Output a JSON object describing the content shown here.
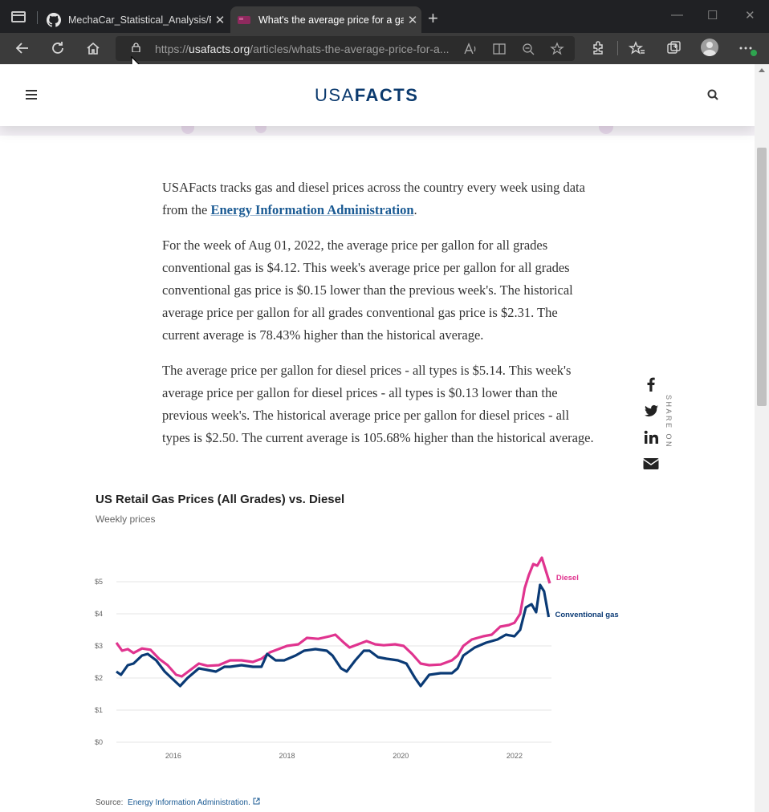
{
  "browser": {
    "tabs": [
      {
        "title": "MechaCar_Statistical_Analysis/RE",
        "close": "✕",
        "active": false
      },
      {
        "title": "What's the average price for a gas",
        "close": "✕",
        "active": true
      }
    ],
    "new_tab": "+",
    "url": {
      "prefix": "https://",
      "host": "usafacts.org",
      "path": "/articles/whats-the-average-price-for-a..."
    },
    "window_controls": {
      "minimize": "—",
      "maximize": "☐",
      "close": "✕"
    }
  },
  "site": {
    "logo_left": "USA",
    "logo_right": "FACTS"
  },
  "article": {
    "p1_before": "USAFacts tracks gas and diesel prices across the country every week using data from the ",
    "p1_link": "Energy Information Administration",
    "p1_after": ".",
    "p2": "For the week of Aug 01, 2022, the average price per gallon for all grades conventional gas is $4.12. This week's average price per gallon for all grades conventional gas price is $0.15 lower than the previous week's. The historical average price per gallon for all grades conventional gas price is $2.31. The current average is 78.43% higher than the historical average.",
    "p3": "The average price per gallon for diesel prices - all types is $5.14. This week's average price per gallon for diesel prices - all types is $0.13 lower than the previous week's. The historical average price per gallon for diesel prices - all types is $2.50. The current average is 105.68% higher than the historical average."
  },
  "share": {
    "label": "SHARE ON"
  },
  "chart_data": {
    "type": "line",
    "title": "US Retail Gas Prices (All Grades) vs. Diesel",
    "subtitle": "Weekly prices",
    "xlabel": "",
    "ylabel": "",
    "xlim": [
      2015.0,
      2022.65
    ],
    "ylim": [
      0,
      5.5
    ],
    "x_ticks": [
      2016,
      2018,
      2020,
      2022
    ],
    "x_tick_labels": [
      "2016",
      "2018",
      "2020",
      "2022"
    ],
    "y_ticks": [
      0,
      1,
      2,
      3,
      4,
      5
    ],
    "y_tick_labels": [
      "$0",
      "$1",
      "$2",
      "$3",
      "$4",
      "$5"
    ],
    "grid": true,
    "legend": "inline-right",
    "series": [
      {
        "name": "Diesel",
        "color": "#e0348f",
        "points": [
          [
            2015.0,
            3.1
          ],
          [
            2015.1,
            2.85
          ],
          [
            2015.2,
            2.9
          ],
          [
            2015.3,
            2.78
          ],
          [
            2015.45,
            2.92
          ],
          [
            2015.6,
            2.88
          ],
          [
            2015.75,
            2.6
          ],
          [
            2015.9,
            2.4
          ],
          [
            2016.05,
            2.1
          ],
          [
            2016.15,
            2.05
          ],
          [
            2016.3,
            2.25
          ],
          [
            2016.45,
            2.45
          ],
          [
            2016.6,
            2.38
          ],
          [
            2016.8,
            2.4
          ],
          [
            2017.0,
            2.55
          ],
          [
            2017.2,
            2.55
          ],
          [
            2017.4,
            2.5
          ],
          [
            2017.55,
            2.6
          ],
          [
            2017.7,
            2.8
          ],
          [
            2017.85,
            2.9
          ],
          [
            2018.0,
            3.0
          ],
          [
            2018.2,
            3.05
          ],
          [
            2018.35,
            3.25
          ],
          [
            2018.55,
            3.22
          ],
          [
            2018.75,
            3.3
          ],
          [
            2018.85,
            3.35
          ],
          [
            2019.0,
            3.1
          ],
          [
            2019.1,
            2.95
          ],
          [
            2019.25,
            3.05
          ],
          [
            2019.4,
            3.15
          ],
          [
            2019.55,
            3.05
          ],
          [
            2019.7,
            3.02
          ],
          [
            2019.9,
            3.05
          ],
          [
            2020.05,
            3.0
          ],
          [
            2020.2,
            2.75
          ],
          [
            2020.35,
            2.45
          ],
          [
            2020.5,
            2.4
          ],
          [
            2020.7,
            2.42
          ],
          [
            2020.9,
            2.55
          ],
          [
            2021.0,
            2.7
          ],
          [
            2021.1,
            3.0
          ],
          [
            2021.25,
            3.2
          ],
          [
            2021.45,
            3.3
          ],
          [
            2021.6,
            3.35
          ],
          [
            2021.75,
            3.6
          ],
          [
            2021.9,
            3.65
          ],
          [
            2022.0,
            3.72
          ],
          [
            2022.1,
            4.0
          ],
          [
            2022.18,
            4.8
          ],
          [
            2022.25,
            5.2
          ],
          [
            2022.33,
            5.55
          ],
          [
            2022.4,
            5.5
          ],
          [
            2022.48,
            5.75
          ],
          [
            2022.55,
            5.35
          ],
          [
            2022.62,
            4.95
          ]
        ]
      },
      {
        "name": "Conventional gas",
        "color": "#0a3a75",
        "points": [
          [
            2015.0,
            2.2
          ],
          [
            2015.08,
            2.1
          ],
          [
            2015.2,
            2.4
          ],
          [
            2015.3,
            2.45
          ],
          [
            2015.45,
            2.7
          ],
          [
            2015.55,
            2.75
          ],
          [
            2015.7,
            2.55
          ],
          [
            2015.85,
            2.2
          ],
          [
            2016.0,
            1.95
          ],
          [
            2016.12,
            1.75
          ],
          [
            2016.25,
            2.0
          ],
          [
            2016.45,
            2.3
          ],
          [
            2016.6,
            2.25
          ],
          [
            2016.75,
            2.2
          ],
          [
            2016.9,
            2.35
          ],
          [
            2017.0,
            2.35
          ],
          [
            2017.2,
            2.4
          ],
          [
            2017.4,
            2.35
          ],
          [
            2017.55,
            2.35
          ],
          [
            2017.65,
            2.75
          ],
          [
            2017.8,
            2.55
          ],
          [
            2017.95,
            2.55
          ],
          [
            2018.15,
            2.7
          ],
          [
            2018.3,
            2.85
          ],
          [
            2018.5,
            2.9
          ],
          [
            2018.7,
            2.85
          ],
          [
            2018.8,
            2.7
          ],
          [
            2018.95,
            2.3
          ],
          [
            2019.05,
            2.2
          ],
          [
            2019.2,
            2.55
          ],
          [
            2019.35,
            2.85
          ],
          [
            2019.45,
            2.85
          ],
          [
            2019.6,
            2.65
          ],
          [
            2019.75,
            2.6
          ],
          [
            2019.95,
            2.55
          ],
          [
            2020.1,
            2.45
          ],
          [
            2020.25,
            2.0
          ],
          [
            2020.35,
            1.75
          ],
          [
            2020.5,
            2.1
          ],
          [
            2020.7,
            2.15
          ],
          [
            2020.9,
            2.15
          ],
          [
            2021.0,
            2.3
          ],
          [
            2021.1,
            2.7
          ],
          [
            2021.3,
            2.95
          ],
          [
            2021.5,
            3.1
          ],
          [
            2021.7,
            3.2
          ],
          [
            2021.85,
            3.35
          ],
          [
            2022.0,
            3.3
          ],
          [
            2022.1,
            3.5
          ],
          [
            2022.2,
            4.2
          ],
          [
            2022.3,
            4.3
          ],
          [
            2022.38,
            4.05
          ],
          [
            2022.45,
            4.9
          ],
          [
            2022.52,
            4.7
          ],
          [
            2022.6,
            3.9
          ]
        ]
      }
    ]
  },
  "source": {
    "label": "Source:",
    "link": "Energy Information Administration."
  }
}
